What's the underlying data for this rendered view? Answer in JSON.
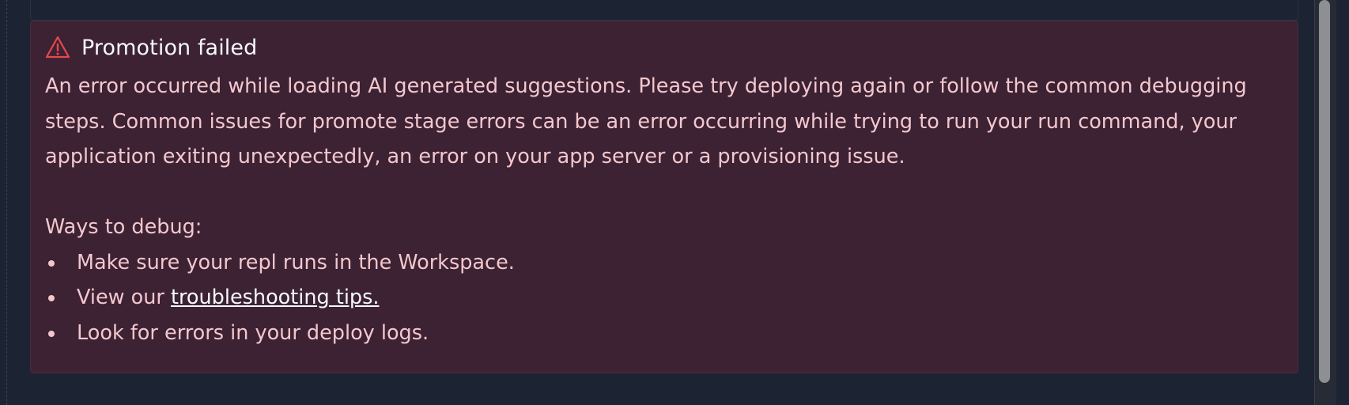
{
  "alert": {
    "title": "Promotion failed",
    "icon": "warning-triangle-icon",
    "accent_color": "#e5484d",
    "paragraph_1": "An error occurred while loading AI generated suggestions. Please try deploying again or follow the common debugging steps. Common issues for promote stage errors can be an error occurring while trying to run your run command, your application exiting unexpectedly, an error on your app server or a provisioning issue.",
    "debug_heading": "Ways to debug:",
    "steps": [
      {
        "text": "Make sure your repl runs in the Workspace."
      },
      {
        "prefix": "View our ",
        "link": "troubleshooting tips."
      },
      {
        "text": "Look for errors in your deploy logs."
      }
    ]
  },
  "colors": {
    "background": "#1c2333",
    "card_background": "#3c2232",
    "text": "#f4c7cf",
    "title_text": "#f5f9fc"
  }
}
